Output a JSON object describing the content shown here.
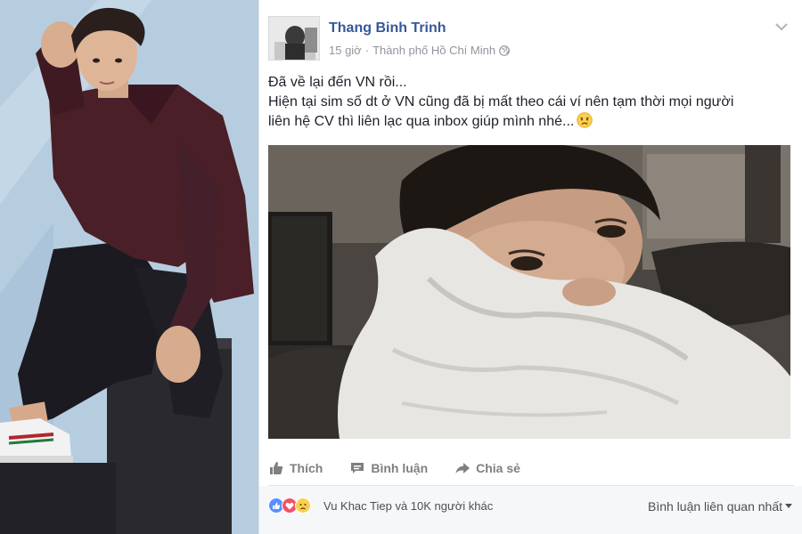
{
  "post": {
    "author": "Thang Binh Trinh",
    "time": "15 giờ",
    "separator": "·",
    "location": "Thành phố Hồ Chí Minh",
    "text_lines": [
      "Đã về lại đến VN rồi...",
      "Hiện tại sim số dt ở VN cũng đã bị mất theo cái ví nên tạm thời mọi người",
      "liên hệ CV thì liên lạc qua inbox giúp mình nhé..."
    ]
  },
  "actions": {
    "like_label": "Thích",
    "comment_label": "Bình luận",
    "share_label": "Chia sẻ"
  },
  "reactions": {
    "types": [
      "like-reaction",
      "love-reaction",
      "sad-reaction"
    ],
    "summary": "Vu Khac Tiep và 10K người khác"
  },
  "comments": {
    "sort_label": "Bình luận liên quan nhất"
  },
  "colors": {
    "author_link": "#365899",
    "meta_gray": "#90949c",
    "action_gray": "#7f7f7f",
    "footer_bg": "#f6f7f9"
  }
}
